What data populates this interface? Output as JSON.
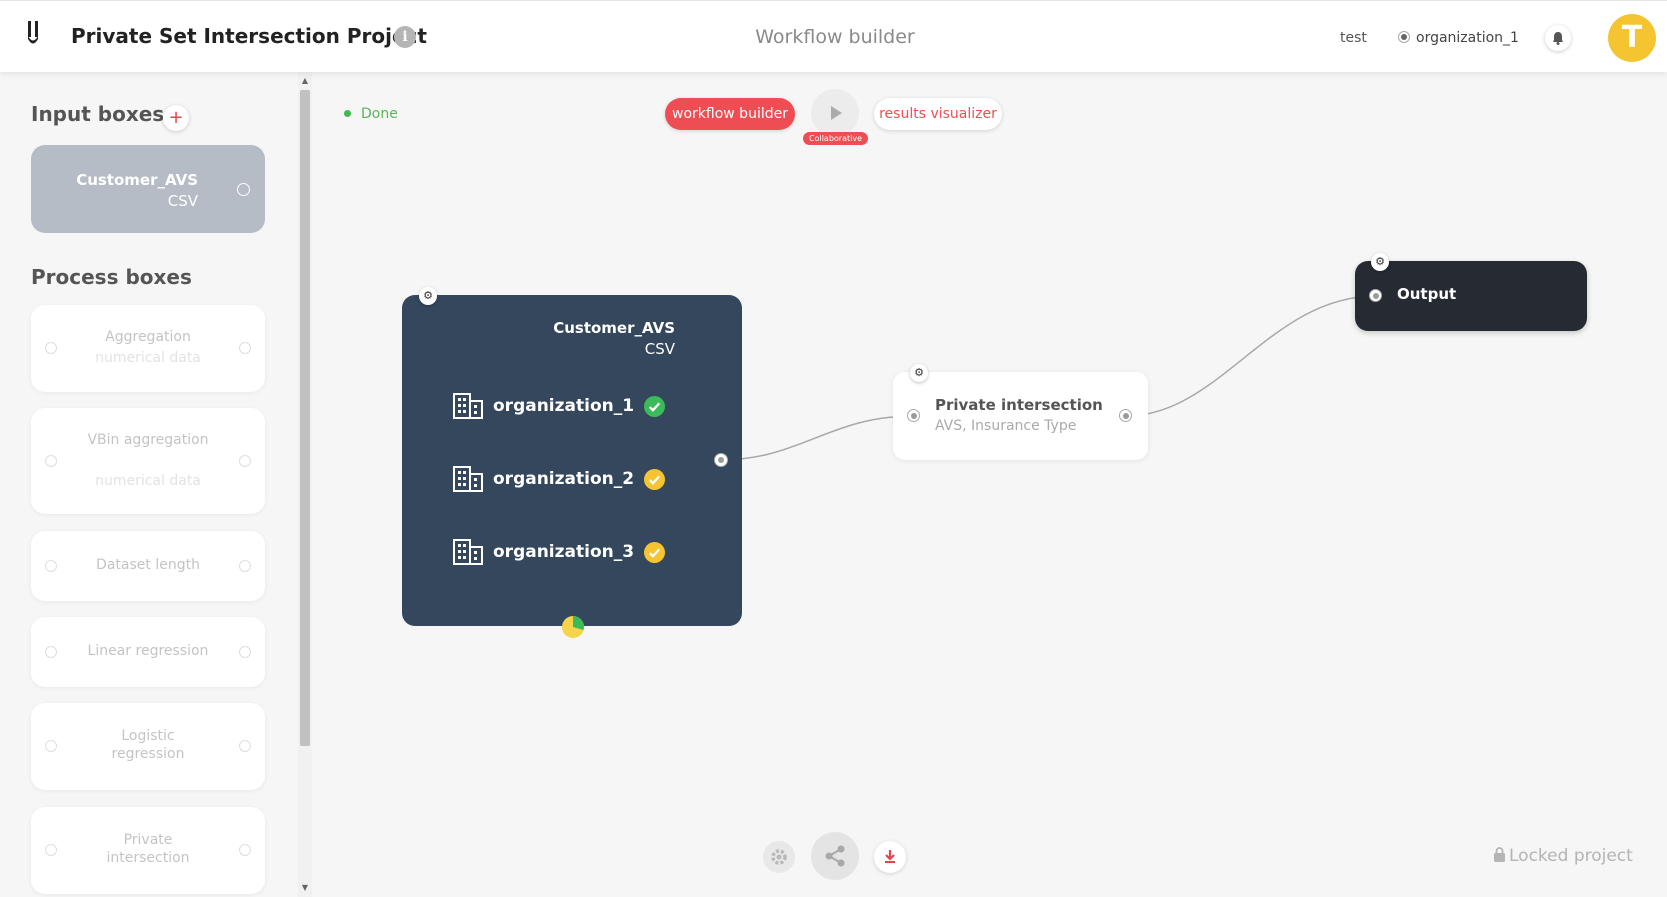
{
  "header": {
    "project_title": "Private Set Intersection Project",
    "info_label": "i",
    "center_title": "Workflow builder",
    "user": "test",
    "organization": "organization_1",
    "avatar_letter": "T"
  },
  "sidebar": {
    "input_section_title": "Input boxes",
    "add_label": "+",
    "input_boxes": [
      {
        "name": "Customer_AVS",
        "type": "CSV"
      }
    ],
    "process_section_title": "Process boxes",
    "process_boxes": [
      {
        "label": "Aggregation",
        "sub": "numerical data"
      },
      {
        "label": "VBin aggregation",
        "sub": "numerical data"
      },
      {
        "label": "Dataset length",
        "sub": ""
      },
      {
        "label": "Linear regression",
        "sub": ""
      },
      {
        "label": "Logistic regression",
        "sub": ""
      },
      {
        "label": "Private intersection",
        "sub": ""
      }
    ]
  },
  "canvas": {
    "status": "Done",
    "tab_builder": "workflow builder",
    "tab_results": "results visualizer",
    "collab_badge": "Collaborative",
    "input_node": {
      "title": "Customer_AVS",
      "type": "CSV",
      "organizations": [
        {
          "name": "organization_1",
          "status": "approved",
          "check_color": "#3cbb5a"
        },
        {
          "name": "organization_2",
          "status": "pending",
          "check_color": "#f5c431"
        },
        {
          "name": "organization_3",
          "status": "pending",
          "check_color": "#f5c431"
        }
      ]
    },
    "process_node": {
      "title": "Private intersection",
      "subtitle": "AVS, Insurance Type"
    },
    "output_node": {
      "title": "Output"
    },
    "locked_label": "Locked project"
  },
  "colors": {
    "accent": "#ee4e53",
    "node_dark": "#34475c",
    "output_dark": "#262b33",
    "avatar": "#f5c431",
    "done_green": "#3fb950"
  }
}
